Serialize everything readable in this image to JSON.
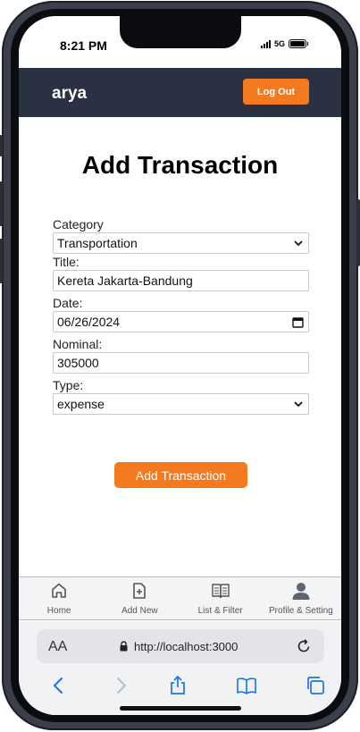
{
  "status_bar": {
    "time": "8:21 PM",
    "network": "5G"
  },
  "header": {
    "brand": "arya",
    "logout_label": "Log Out"
  },
  "page": {
    "title": "Add Transaction"
  },
  "form": {
    "category_label": "Category",
    "category_value": "Transportation",
    "title_label": "Title:",
    "title_value": "Kereta Jakarta-Bandung",
    "date_label": "Date:",
    "date_value": "06/26/2024",
    "nominal_label": "Nominal:",
    "nominal_value": "305000",
    "type_label": "Type:",
    "type_value": "expense",
    "submit_label": "Add Transaction"
  },
  "bottom_nav": {
    "items": [
      {
        "label": "Home",
        "icon": "home-icon"
      },
      {
        "label": "Add New",
        "icon": "add-new-icon"
      },
      {
        "label": "List & Filter",
        "icon": "book-icon"
      },
      {
        "label": "Profile & Setting",
        "icon": "user-icon"
      }
    ]
  },
  "browser": {
    "text_size_label": "AA",
    "url": "http://localhost:3000"
  },
  "colors": {
    "accent": "#f47a1f",
    "header_bg": "#2a3142",
    "link_blue": "#1a73e8"
  }
}
